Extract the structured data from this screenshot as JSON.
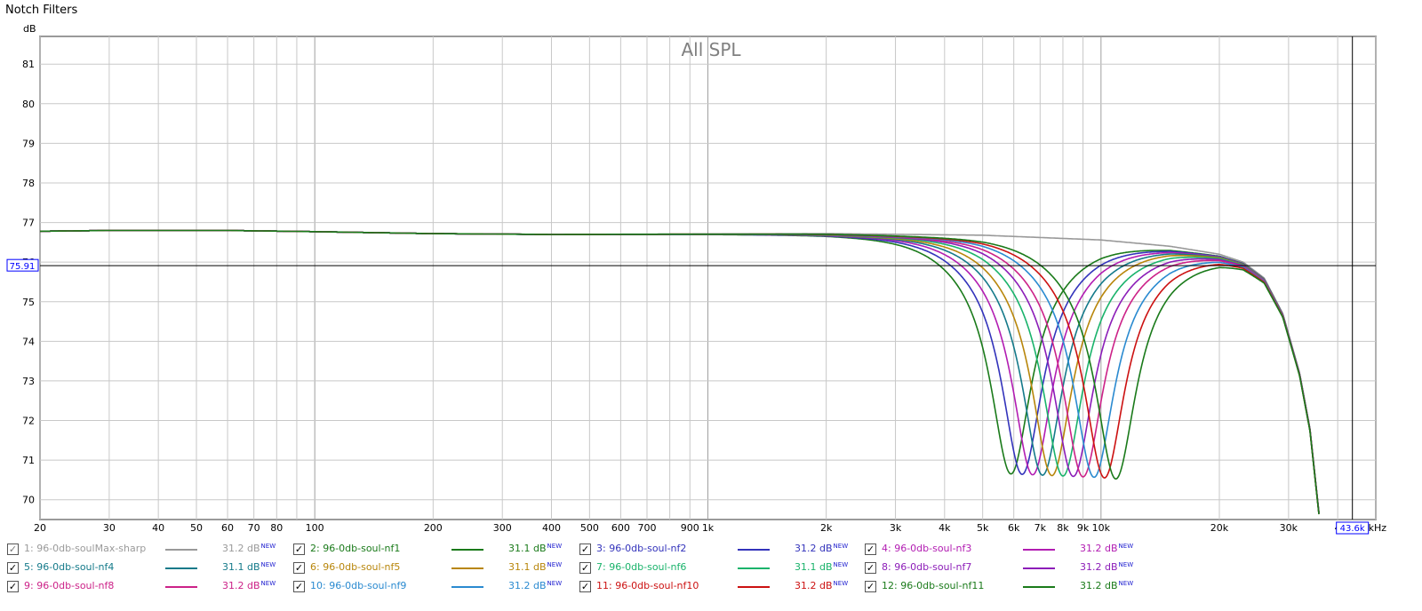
{
  "window": {
    "title": "Notch Filters"
  },
  "cursor": {
    "y_value": "75.91",
    "x_value": "43.6k"
  },
  "colors": {
    "grid": "#c8c8c8",
    "grid_decade": "#a0a0a0",
    "plot_border": "#9a9a9a",
    "cursor_box": "#0000ff",
    "title": "#808080"
  },
  "chart_data": {
    "type": "line",
    "title": "All SPL",
    "ylabel": "dB",
    "xlabel": "",
    "x_unit_label": "Hz",
    "x_scale": "log",
    "xlim": [
      20,
      50000
    ],
    "ylim": [
      69.5,
      81.7
    ],
    "grid": true,
    "y_ticks": [
      70,
      71,
      72,
      73,
      74,
      75,
      76,
      77,
      78,
      79,
      80,
      81
    ],
    "x_ticks": [
      {
        "v": 20,
        "label": "20"
      },
      {
        "v": 30,
        "label": "30"
      },
      {
        "v": 40,
        "label": "40"
      },
      {
        "v": 50,
        "label": "50"
      },
      {
        "v": 60,
        "label": "60"
      },
      {
        "v": 70,
        "label": "70"
      },
      {
        "v": 80,
        "label": "80"
      },
      {
        "v": 100,
        "label": "100"
      },
      {
        "v": 200,
        "label": "200"
      },
      {
        "v": 300,
        "label": "300"
      },
      {
        "v": 400,
        "label": "400"
      },
      {
        "v": 500,
        "label": "500"
      },
      {
        "v": 600,
        "label": "600"
      },
      {
        "v": 700,
        "label": "700"
      },
      {
        "v": 900,
        "label": "900"
      },
      {
        "v": 1000,
        "label": "1k"
      },
      {
        "v": 2000,
        "label": "2k"
      },
      {
        "v": 3000,
        "label": "3k"
      },
      {
        "v": 4000,
        "label": "4k"
      },
      {
        "v": 5000,
        "label": "5k"
      },
      {
        "v": 6000,
        "label": "6k"
      },
      {
        "v": 7000,
        "label": "7k"
      },
      {
        "v": 8000,
        "label": "8k"
      },
      {
        "v": 9000,
        "label": "9k"
      },
      {
        "v": 10000,
        "label": "10k"
      },
      {
        "v": 20000,
        "label": "20k"
      },
      {
        "v": 30000,
        "label": "30k"
      },
      {
        "v": 40000,
        "label": "4"
      },
      {
        "v": 50000,
        "label": "0kHz"
      }
    ],
    "response_common": {
      "points": [
        [
          20,
          76.78
        ],
        [
          30,
          76.8
        ],
        [
          60,
          76.8
        ],
        [
          100,
          76.77
        ],
        [
          200,
          76.72
        ],
        [
          400,
          76.7
        ],
        [
          1000,
          76.71
        ],
        [
          2000,
          76.72
        ],
        [
          5000,
          76.68
        ],
        [
          10000,
          76.56
        ],
        [
          15000,
          76.4
        ],
        [
          20000,
          76.2
        ],
        [
          23000,
          76.0
        ],
        [
          26000,
          75.6
        ],
        [
          29000,
          74.7
        ],
        [
          32000,
          73.2
        ],
        [
          34000,
          71.8
        ],
        [
          36000,
          69.5
        ]
      ],
      "notch_depth_db": 6.0,
      "notch_q": 3.5,
      "notch_shoulder_db": 0.6
    },
    "series": [
      {
        "name": "96-0db-soulMax-sharp",
        "color": "#999999",
        "notch_hz": null,
        "value": "31.2 dB",
        "checked": true,
        "disabled": true
      },
      {
        "name": "96-0db-soul-nf1",
        "color": "#1a7a1a",
        "notch_hz": 5900,
        "value": "31.1 dB",
        "checked": true
      },
      {
        "name": "96-0db-soul-nf2",
        "color": "#3333bb",
        "notch_hz": 6300,
        "value": "31.2 dB",
        "checked": true
      },
      {
        "name": "96-0db-soul-nf3",
        "color": "#b21db2",
        "notch_hz": 6700,
        "value": "31.2 dB",
        "checked": true
      },
      {
        "name": "96-0db-soul-nf4",
        "color": "#157a8a",
        "notch_hz": 7100,
        "value": "31.1 dB",
        "checked": true
      },
      {
        "name": "96-0db-soul-nf5",
        "color": "#b8860b",
        "notch_hz": 7500,
        "value": "31.1 dB",
        "checked": true
      },
      {
        "name": "96-0db-soul-nf6",
        "color": "#1ab36b",
        "notch_hz": 8000,
        "value": "31.1 dB",
        "checked": true
      },
      {
        "name": "96-0db-soul-nf7",
        "color": "#8c1db8",
        "notch_hz": 8500,
        "value": "31.2 dB",
        "checked": true
      },
      {
        "name": "96-0db-soul-nf8",
        "color": "#cc2288",
        "notch_hz": 9000,
        "value": "31.2 dB",
        "checked": true
      },
      {
        "name": "96-0db-soul-nf9",
        "color": "#2a8ad0",
        "notch_hz": 9600,
        "value": "31.2 dB",
        "checked": true
      },
      {
        "name": "96-0db-soul-nf10",
        "color": "#cc1111",
        "notch_hz": 10200,
        "value": "31.2 dB",
        "checked": true
      },
      {
        "name": "96-0db-soul-nf11",
        "color": "#1a7a1a",
        "notch_hz": 10900,
        "value": "31.2 dB",
        "checked": true
      }
    ]
  },
  "legend": {
    "new_badge": "NEW"
  }
}
